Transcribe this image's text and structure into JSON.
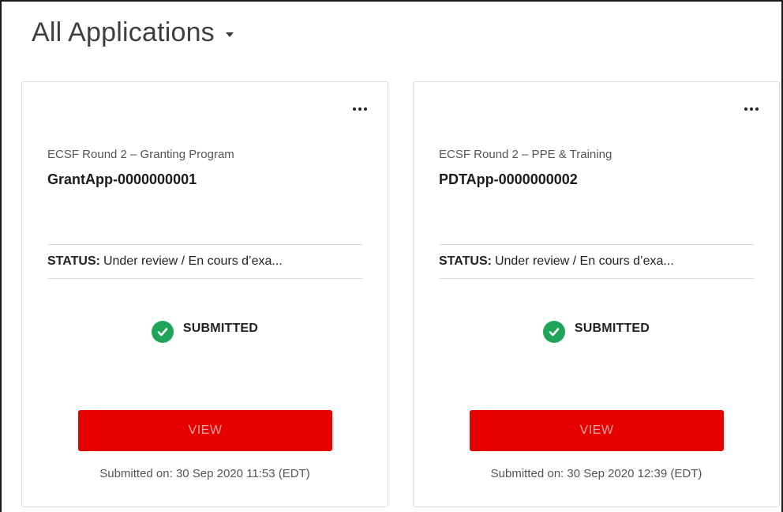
{
  "header": {
    "title": "All Applications"
  },
  "colors": {
    "primary_button": "#e70000",
    "success": "#1fa55a",
    "border": "#dddbda"
  },
  "cards": [
    {
      "program": "ECSF Round 2 – Granting Program",
      "app_id": "GrantApp-0000000001",
      "status_label": "STATUS:",
      "status_value": "Under review / En cours d’exa...",
      "badge_icon": "check-circle-icon",
      "badge_text": "SUBMITTED",
      "view_label": "VIEW",
      "submitted_on": "Submitted on: 30 Sep 2020 11:53 (EDT)"
    },
    {
      "program": "ECSF Round 2 – PPE & Training",
      "app_id": "PDTApp-0000000002",
      "status_label": "STATUS:",
      "status_value": "Under review / En cours d’exa...",
      "badge_icon": "check-circle-icon",
      "badge_text": "SUBMITTED",
      "view_label": "VIEW",
      "submitted_on": "Submitted on: 30 Sep 2020 12:39 (EDT)"
    }
  ]
}
